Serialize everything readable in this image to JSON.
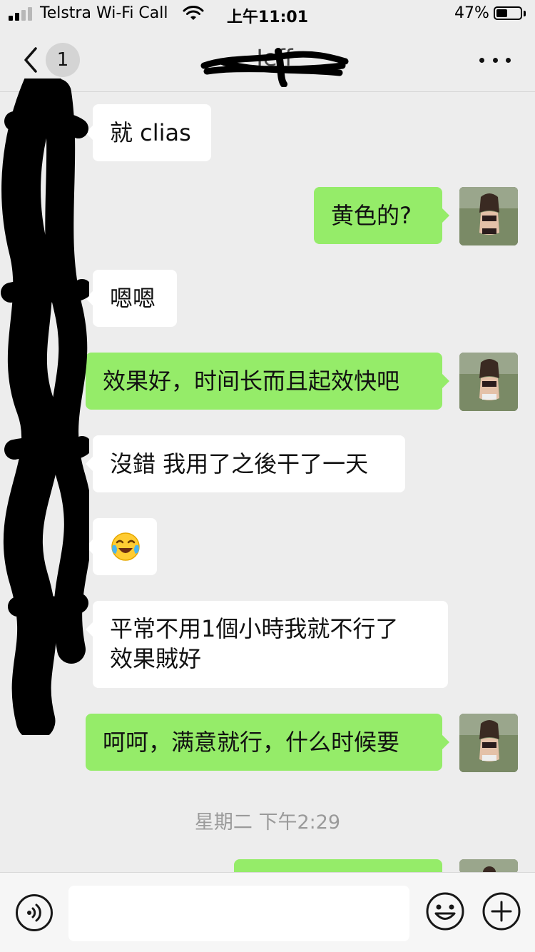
{
  "status_bar": {
    "carrier": "Telstra Wi-Fi Call",
    "time": "上午11:01",
    "battery_percent": "47%",
    "battery_level": 0.47,
    "signal_bars_active": 2,
    "signal_bars_total": 4
  },
  "nav": {
    "unread_count": "1",
    "title": "Jeff",
    "back_icon": "chevron-left-icon",
    "more_icon": "ellipsis-icon"
  },
  "messages": [
    {
      "side": "in",
      "text": "就 clias"
    },
    {
      "side": "out",
      "text": "黄色的?"
    },
    {
      "side": "in",
      "text": "嗯嗯"
    },
    {
      "side": "out",
      "text": "效果好，时间长而且起效快吧"
    },
    {
      "side": "in",
      "text": "沒錯 我用了之後干了一天"
    },
    {
      "side": "in",
      "text": "",
      "emoji": "face-with-tears-of-joy"
    },
    {
      "side": "in",
      "text_line1": "平常不用1個小時我就不行了",
      "text_line2": "效果賊好"
    },
    {
      "side": "out",
      "text": "呵呵，满意就行，什么时候要"
    }
  ],
  "timestamp": "星期二 下午2:29",
  "input_bar": {
    "voice_icon": "voice-icon",
    "emoji_icon": "smiley-icon",
    "plus_icon": "plus-circle-icon",
    "text_value": ""
  },
  "colors": {
    "background": "#ededed",
    "incoming_bubble": "#ffffff",
    "outgoing_bubble": "#95ec69",
    "redaction": "#000000"
  }
}
